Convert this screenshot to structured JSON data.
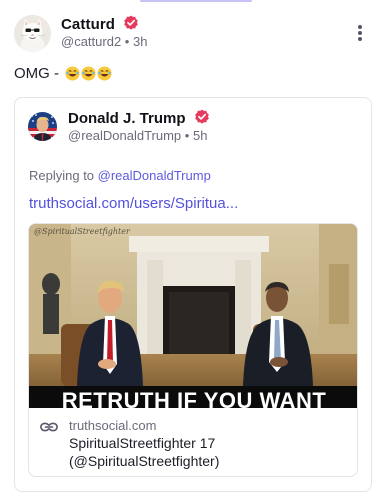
{
  "post": {
    "author": "Catturd",
    "handle": "@catturd2",
    "time": "3h",
    "meta_separator": "•",
    "text": "OMG - ",
    "emojis": [
      "laughing-emoji",
      "laughing-emoji",
      "laughing-emoji"
    ]
  },
  "quoted_post": {
    "author": "Donald J. Trump",
    "handle": "@realDonaldTrump",
    "time": "5h",
    "meta_separator": "•",
    "replying_prefix": "Replying to ",
    "replying_to": "@realDonaldTrump",
    "link_text": "truthsocial.com/users/Spiritua..."
  },
  "link_card": {
    "image_banner_text": "RETRUTH IF YOU WANT",
    "image_watermark": "@SpiritualStreetfighter",
    "domain": "truthsocial.com",
    "title_line1": "SpiritualStreetfighter 17",
    "title_line2": "(@SpiritualStreetfighter)"
  },
  "colors": {
    "accent": "#5451dc",
    "verified_badge": "#e5395d",
    "muted_text": "#6b6b7b"
  },
  "icons": {
    "verified": "verified-badge-icon",
    "more": "more-vertical-icon",
    "link": "link-icon"
  }
}
